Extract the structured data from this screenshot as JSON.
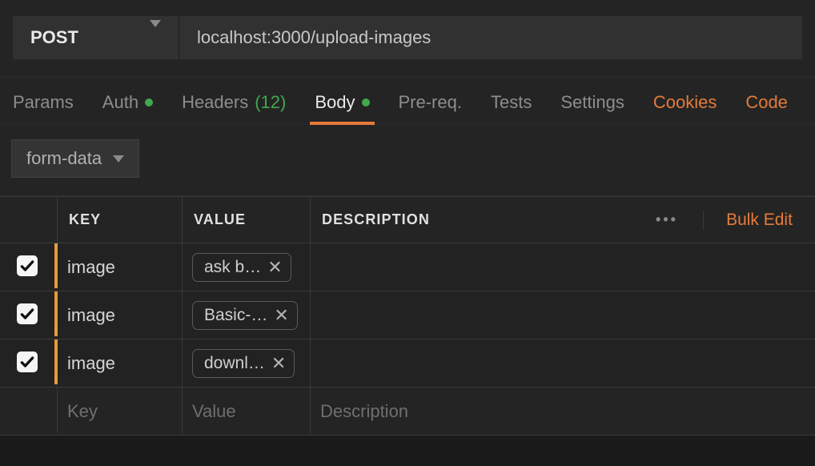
{
  "request": {
    "method": "POST",
    "url": "localhost:3000/upload-images"
  },
  "tabs": {
    "params": "Params",
    "auth": "Auth",
    "headers_label": "Headers",
    "headers_count": "(12)",
    "body": "Body",
    "prereq": "Pre-req.",
    "tests": "Tests",
    "settings": "Settings",
    "cookies": "Cookies",
    "code": "Code"
  },
  "body": {
    "type": "form-data",
    "columns": {
      "key": "KEY",
      "value": "VALUE",
      "description": "DESCRIPTION"
    },
    "more_icon": "•••",
    "bulk_edit": "Bulk Edit",
    "rows": [
      {
        "checked": true,
        "key": "image",
        "file": "ask b…"
      },
      {
        "checked": true,
        "key": "image",
        "file": "Basic-…"
      },
      {
        "checked": true,
        "key": "image",
        "file": "downl…"
      }
    ],
    "placeholder": {
      "key": "Key",
      "value": "Value",
      "description": "Description"
    }
  }
}
